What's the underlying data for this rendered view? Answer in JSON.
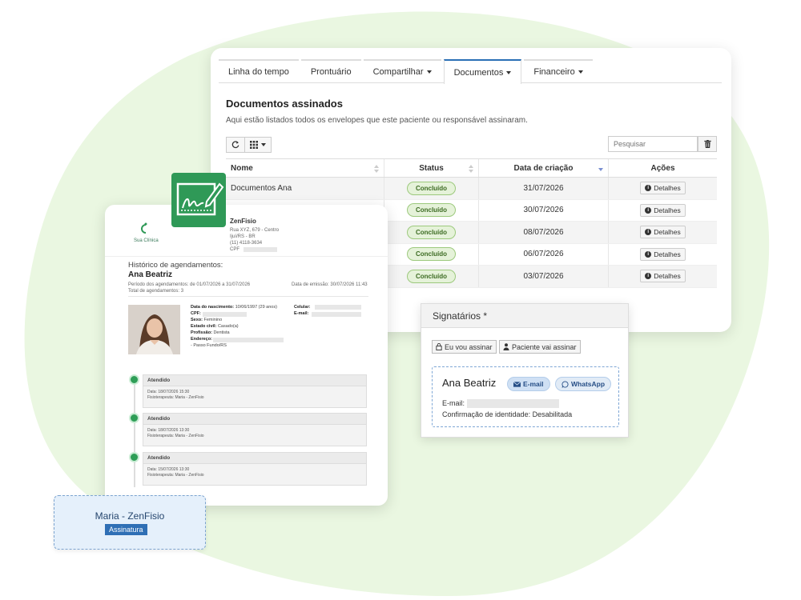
{
  "tabs": [
    {
      "label": "Linha do tempo",
      "dropdown": false
    },
    {
      "label": "Prontuário",
      "dropdown": false
    },
    {
      "label": "Compartilhar",
      "dropdown": true
    },
    {
      "label": "Documentos",
      "dropdown": true,
      "active": true
    },
    {
      "label": "Financeiro",
      "dropdown": true
    }
  ],
  "documents": {
    "title": "Documentos assinados",
    "subtitle": "Aqui estão listados todos os envelopes que este paciente ou responsável assinaram.",
    "search_placeholder": "Pesquisar",
    "columns": [
      "Nome",
      "Status",
      "Data de criação",
      "Ações"
    ],
    "rows": [
      {
        "name": "Documentos Ana",
        "status": "Concluído",
        "date": "31/07/2026",
        "action": "Detalhes"
      },
      {
        "name": "",
        "status": "Concluído",
        "date": "30/07/2026",
        "action": "Detalhes"
      },
      {
        "name": "",
        "status": "Concluído",
        "date": "08/07/2026",
        "action": "Detalhes"
      },
      {
        "name": "",
        "status": "Concluído",
        "date": "06/07/2026",
        "action": "Detalhes"
      },
      {
        "name": "",
        "status": "Concluído",
        "date": "03/07/2026",
        "action": "Detalhes"
      }
    ]
  },
  "signatarios": {
    "title": "Signatários *",
    "btn_self": "Eu vou assinar",
    "btn_patient": "Paciente vai assinar",
    "name": "Ana Beatriz",
    "email_btn": "E-mail",
    "whatsapp_btn": "WhatsApp",
    "email_label": "E-mail:",
    "identity": "Confirmação de identidade: Desabilitada"
  },
  "report": {
    "logo_text": "Sua Clínica",
    "company": "ZenFisio",
    "address": [
      "Rua XYZ, 679 - Centro",
      "Ijuí/RS - BR",
      "(11) 4118-3634",
      "CPF"
    ],
    "heading": "Histórico de agendamentos:",
    "patient": "Ana Beatriz",
    "period": "Período dos agendamentos: de 01/07/2026 a 31/07/2026",
    "total": "Total de agendamentos: 3",
    "issued": "Data de emissão: 30/07/2026 11:43",
    "fields": {
      "birth_label": "Data do nascimento:",
      "birth_value": "10/06/1997 (29 anos)",
      "cpf_label": "CPF:",
      "sex_label": "Sexo:",
      "sex_value": "Feminino",
      "civil_label": "Estado civil:",
      "civil_value": "Casado(a)",
      "prof_label": "Profissão:",
      "prof_value": "Dentista",
      "addr_label": "Endereço:",
      "addr_value": "- Passo Fundo/RS",
      "cell_label": "Celular:",
      "email_label": "E-mail:"
    },
    "timeline": [
      {
        "status": "Atendido",
        "date": "Data: 18/07/2026 15:30",
        "pro": "Fisioterapeuta: Maria - ZenFisio"
      },
      {
        "status": "Atendido",
        "date": "Data: 18/07/2026 13:30",
        "pro": "Fisioterapeuta: Maria - ZenFisio"
      },
      {
        "status": "Atendido",
        "date": "Data: 15/07/2026 13:30",
        "pro": "Fisioterapeuta: Maria - ZenFisio"
      }
    ]
  },
  "signature_card": {
    "name": "Maria - ZenFisio",
    "badge": "Assinatura"
  },
  "colors": {
    "blob": "#eaf7e1",
    "accent_green": "#2f9957",
    "tab_active": "#2b6fb5",
    "status_badge_bg": "#e5f2d9"
  }
}
